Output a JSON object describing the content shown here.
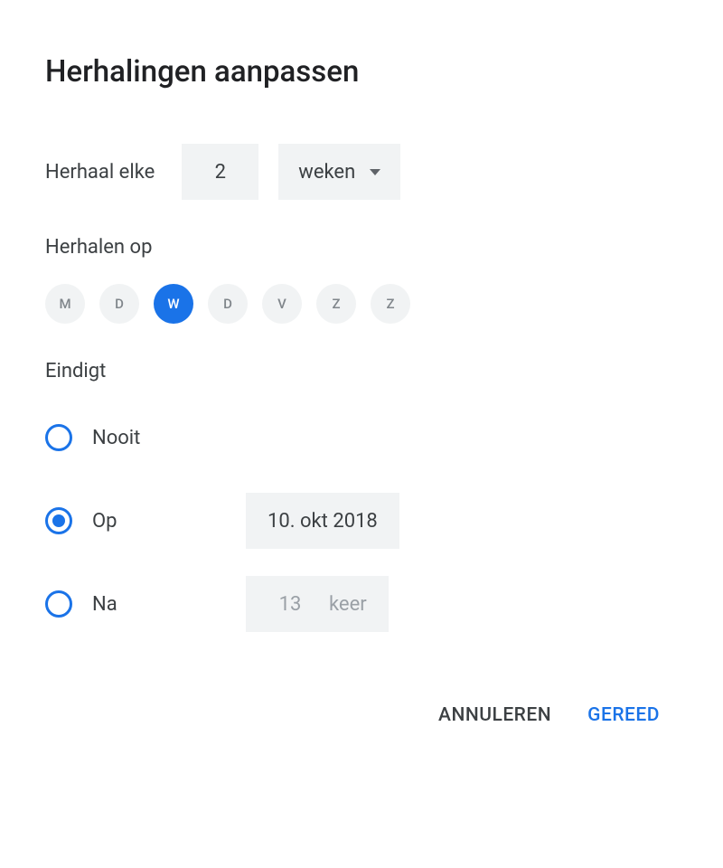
{
  "title": "Herhalingen aanpassen",
  "repeat": {
    "label": "Herhaal elke",
    "count": "2",
    "unit": "weken"
  },
  "repeat_on": {
    "label": "Herhalen op",
    "days": [
      {
        "letter": "M",
        "selected": false
      },
      {
        "letter": "D",
        "selected": false
      },
      {
        "letter": "W",
        "selected": true
      },
      {
        "letter": "D",
        "selected": false
      },
      {
        "letter": "V",
        "selected": false
      },
      {
        "letter": "Z",
        "selected": false
      },
      {
        "letter": "Z",
        "selected": false
      }
    ]
  },
  "ends": {
    "label": "Eindigt",
    "options": {
      "never": {
        "label": "Nooit",
        "selected": false
      },
      "on": {
        "label": "Op",
        "selected": true,
        "date": "10. okt 2018"
      },
      "after": {
        "label": "Na",
        "selected": false,
        "count": "13",
        "suffix": "keer"
      }
    }
  },
  "actions": {
    "cancel": "ANNULEREN",
    "done": "GEREED"
  }
}
